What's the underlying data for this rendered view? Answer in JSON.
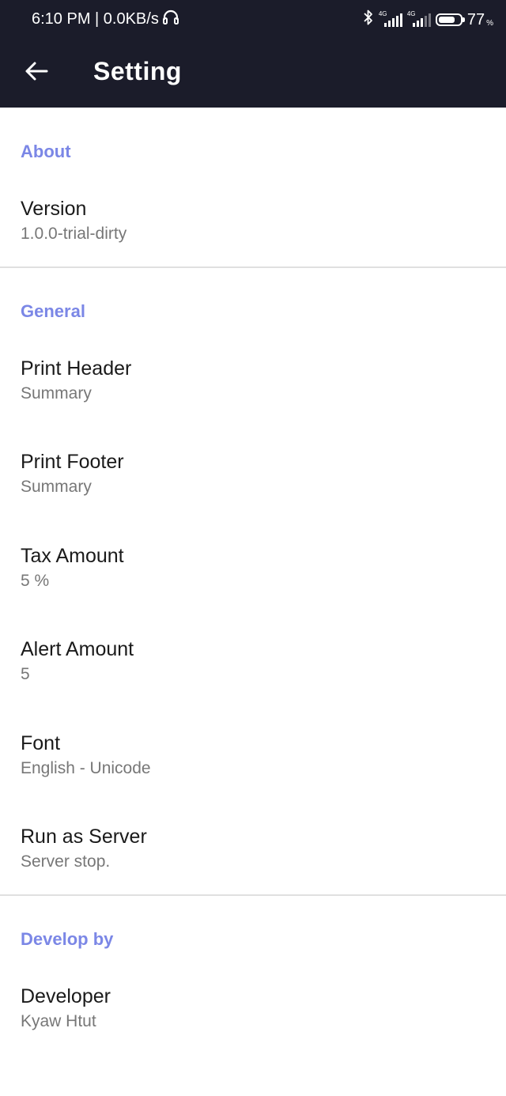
{
  "status_bar": {
    "time_speed": "6:10 PM | 0.0KB/s",
    "icons": [
      "headphones-icon",
      "bluetooth-icon",
      "signal-4g-icon",
      "signal-4g-icon",
      "battery-icon"
    ],
    "signal_tag": "4G",
    "battery_level": 0.77,
    "battery_percent": "77",
    "battery_unit": "%"
  },
  "app_bar": {
    "back_icon": "arrow-left-icon",
    "title": "Setting"
  },
  "sections": {
    "about": {
      "header": "About",
      "items": [
        {
          "title": "Version",
          "summary": "1.0.0-trial-dirty"
        }
      ]
    },
    "general": {
      "header": "General",
      "items": [
        {
          "title": "Print Header",
          "summary": "Summary"
        },
        {
          "title": "Print Footer",
          "summary": "Summary"
        },
        {
          "title": "Tax Amount",
          "summary": "5 %"
        },
        {
          "title": "Alert Amount",
          "summary": "5"
        },
        {
          "title": "Font",
          "summary": "English - Unicode"
        },
        {
          "title": "Run as Server",
          "summary": "Server stop."
        }
      ]
    },
    "develop": {
      "header": "Develop by",
      "items": [
        {
          "title": "Developer",
          "summary": "Kyaw Htut"
        }
      ]
    }
  },
  "colors": {
    "app_bar": "#1b1c2a",
    "section_header": "#7b87e6",
    "summary_text": "#777777",
    "divider": "#e0e0e0"
  }
}
